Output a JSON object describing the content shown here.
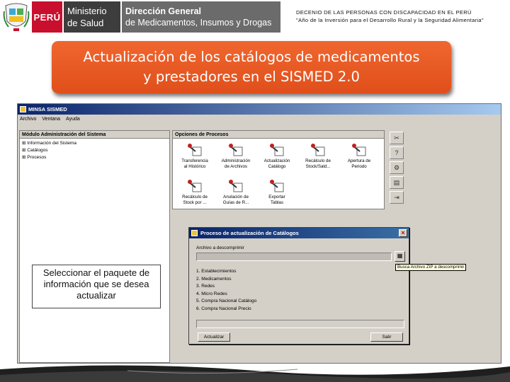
{
  "header": {
    "country": "PERÚ",
    "ministry_line1": "Ministerio",
    "ministry_line2": "de Salud",
    "direction_line1": "Dirección General",
    "direction_line2": "de Medicamentos, Insumos y Drogas",
    "decenio_line1": "DECENIO DE LAS PERSONAS CON DISCAPACIDAD EN EL PERÚ",
    "decenio_line2": "\"Año de la Inversión para el Desarrollo Rural y la Seguridad Alimentaria\""
  },
  "banner": {
    "line1": "Actualización de los catálogos de medicamentos",
    "line2": "y prestadores en el SISMED 2.0"
  },
  "app": {
    "window_title": "MINSA SISMED",
    "menu": [
      "Archivo",
      "Ventana",
      "Ayuda"
    ],
    "left_panel": {
      "title": "Módulo Administración del Sistema",
      "items": [
        "Información del Sistema",
        "Catálogos",
        "Procesos"
      ]
    },
    "right_panel": {
      "title": "Opciones de Procesos",
      "processes": [
        {
          "line1": "Transferencia",
          "line2": "al Histórico"
        },
        {
          "line1": "Administración",
          "line2": "de Archivos"
        },
        {
          "line1": "Actualización",
          "line2": "Catálogo"
        },
        {
          "line1": "Recálculo de",
          "line2": "Stock/Sald..."
        },
        {
          "line1": "Apertura de",
          "line2": "Periodo"
        },
        {
          "line1": "Recálculo de",
          "line2": "Stock por ..."
        },
        {
          "line1": "Anulación de",
          "line2": "Guías de R..."
        },
        {
          "line1": "Exportar",
          "line2": "Tablas"
        }
      ]
    },
    "toolbar_icons": [
      "tools-icon",
      "help-icon",
      "network-icon",
      "document-icon",
      "exit-icon"
    ],
    "dialog": {
      "title": "Proceso de actualización de Catálogos",
      "label": "Archivo a descomprimir",
      "input_value": "",
      "items": [
        "1. Establecimientos",
        "2. Medicamentos",
        "3. Redes",
        "4. Micro Redes",
        "5. Compra Nacional Catálogo",
        "6. Compra Nacional Precio"
      ],
      "progress": 0,
      "actualizar_label": "Actualizar",
      "salir_label": "Salir"
    },
    "tooltip": "Busca Archivo ZIP a descomprimir"
  },
  "callout": {
    "text": "Seleccionar el paquete de información que se desea actualizar"
  },
  "colors": {
    "banner": "#e8592a",
    "peru_red": "#c8102e",
    "titlebar": "#0a246a"
  }
}
